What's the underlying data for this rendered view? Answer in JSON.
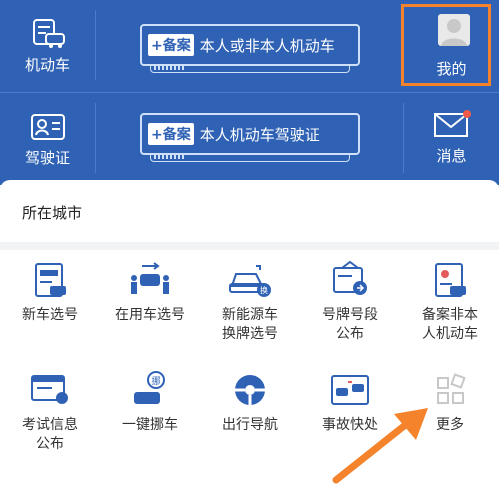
{
  "header": {
    "row1": {
      "left_label": "机动车",
      "beian_tag": "+备案",
      "beian_text": "本人或非本人机动车",
      "right_label": "我的"
    },
    "row2": {
      "left_label": "驾驶证",
      "beian_tag": "+备案",
      "beian_text": "本人机动车驾驶证",
      "right_label": "消息"
    }
  },
  "panel": {
    "city_label": "所在城市",
    "items": [
      {
        "label": "新车选号",
        "icon": "new-car-plate-icon"
      },
      {
        "label": "在用车选号",
        "icon": "used-car-plate-icon"
      },
      {
        "label": "新能源车\n换牌选号",
        "icon": "ev-plate-icon"
      },
      {
        "label": "号牌号段\n公布",
        "icon": "plate-range-icon"
      },
      {
        "label": "备案非本\n人机动车",
        "icon": "register-car-icon"
      },
      {
        "label": "考试信息\n公布",
        "icon": "exam-info-icon"
      },
      {
        "label": "一键挪车",
        "icon": "move-car-icon"
      },
      {
        "label": "出行导航",
        "icon": "navigation-icon"
      },
      {
        "label": "事故快处",
        "icon": "accident-icon"
      },
      {
        "label": "更多",
        "icon": "more-icon"
      }
    ]
  },
  "colors": {
    "header_bg": "#2f62b5",
    "highlight": "#f4832b",
    "icon_blue": "#2f62b5"
  }
}
